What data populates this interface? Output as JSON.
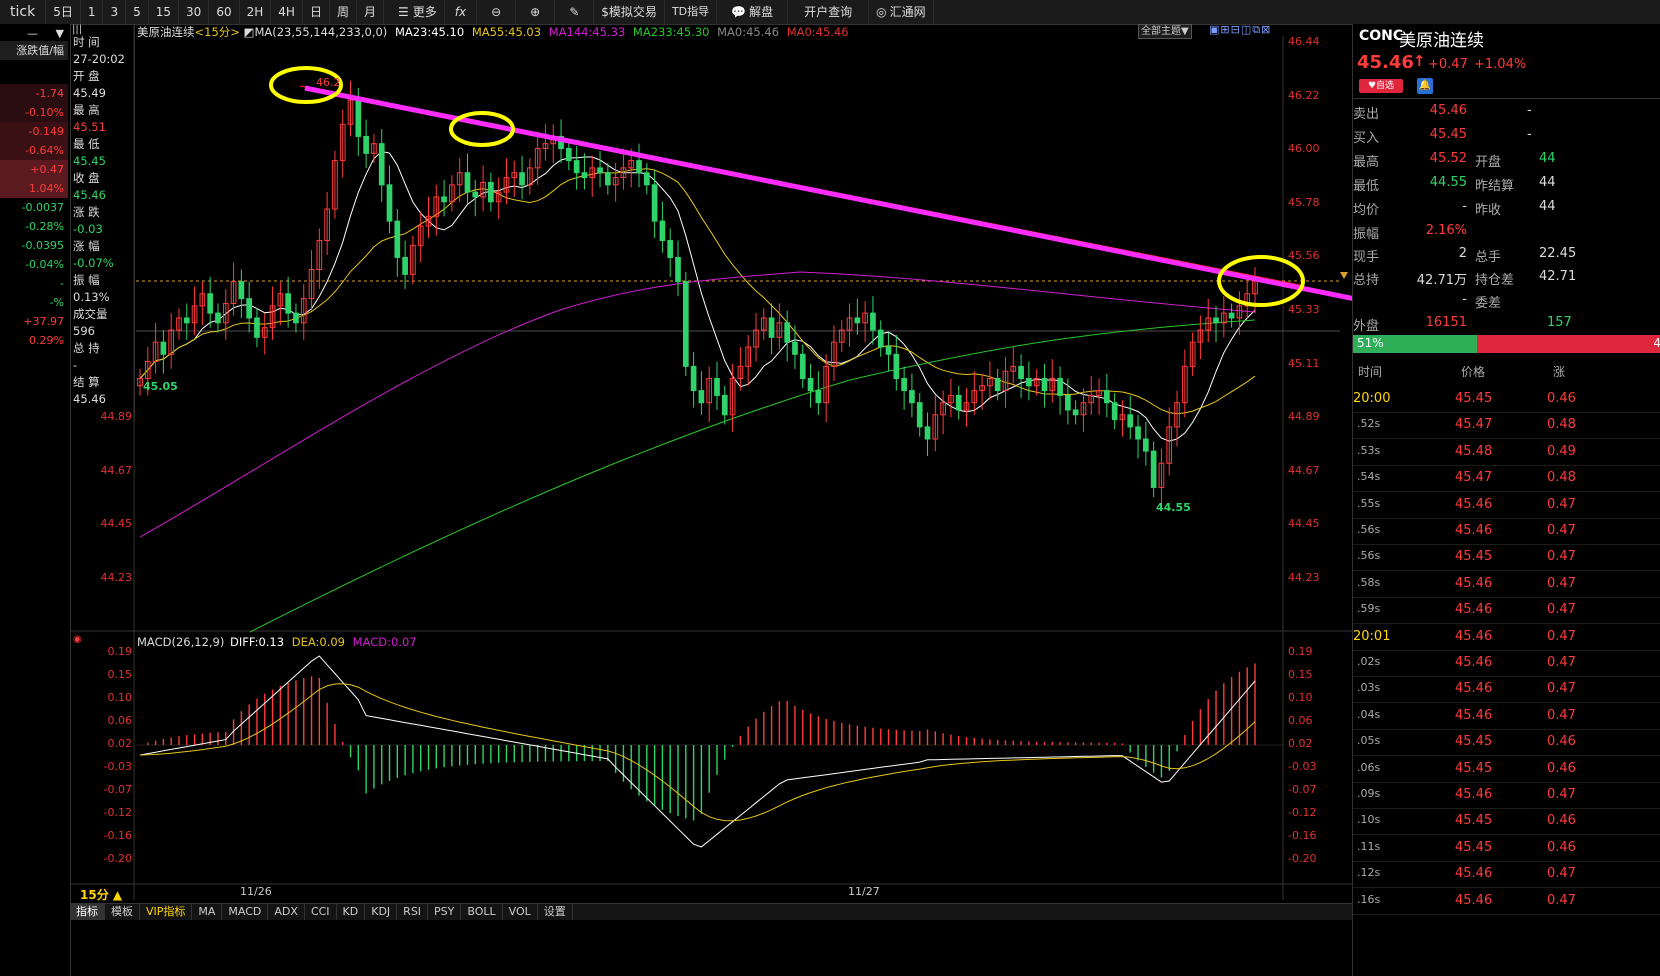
{
  "toolbar": {
    "items": [
      "tick",
      "5日",
      "1",
      "3",
      "5",
      "15",
      "30",
      "60",
      "2H",
      "4H",
      "日",
      "周",
      "月",
      "更多",
      "fx",
      "",
      "",
      "",
      "模拟交易",
      "TD指导",
      "解盘",
      "开户查询",
      "汇通网"
    ]
  },
  "left_strip": {
    "header": "涨跌值/幅",
    "rows": [
      {
        "text": "-1.74",
        "color": "red"
      },
      {
        "text": "-0.10%",
        "color": "red"
      },
      {
        "text": "-0.149",
        "color": "red"
      },
      {
        "text": "-0.64%",
        "color": "red"
      },
      {
        "text": "+0.47",
        "color": "red"
      },
      {
        "text": "1.04%",
        "color": "red"
      },
      {
        "text": "-0.0037",
        "color": "green"
      },
      {
        "text": "-0.28%",
        "color": "green"
      },
      {
        "text": "-0.0395",
        "color": "green"
      },
      {
        "text": "-0.04%",
        "color": "green"
      },
      {
        "text": "-",
        "color": "green"
      },
      {
        "text": "-%",
        "color": "green"
      },
      {
        "text": "+37.97",
        "color": "red"
      },
      {
        "text": "0.29%",
        "color": "red"
      }
    ]
  },
  "info": {
    "rows": [
      {
        "text": "时 间",
        "color": "white"
      },
      {
        "text": "27-20:02",
        "color": "white"
      },
      {
        "text": "开 盘",
        "color": "white"
      },
      {
        "text": "45.49",
        "color": "white"
      },
      {
        "text": "最 高",
        "color": "white"
      },
      {
        "text": "45.51",
        "color": "red"
      },
      {
        "text": "最 低",
        "color": "white"
      },
      {
        "text": "45.45",
        "color": "green"
      },
      {
        "text": "收 盘",
        "color": "white"
      },
      {
        "text": "45.46",
        "color": "green"
      },
      {
        "text": "涨 跌",
        "color": "white"
      },
      {
        "text": "-0.03",
        "color": "green"
      },
      {
        "text": "涨 幅",
        "color": "white"
      },
      {
        "text": "-0.07%",
        "color": "green"
      },
      {
        "text": "振 幅",
        "color": "white"
      },
      {
        "text": "0.13%",
        "color": "white"
      },
      {
        "text": "成交量",
        "color": "white"
      },
      {
        "text": "596",
        "color": "white"
      },
      {
        "text": "总 持",
        "color": "white"
      },
      {
        "text": "-",
        "color": "white"
      },
      {
        "text": "结 算",
        "color": "white"
      },
      {
        "text": "45.46",
        "color": "white"
      }
    ]
  },
  "chart_header": {
    "symbol": "美原油连续",
    "period": "<15分>",
    "ma_label": "MA(23,55,144,233,0,0)",
    "ma23": "MA23:45.10",
    "ma55": "MA55:45.03",
    "ma144": "MA144:45.33",
    "ma233": "MA233:45.30",
    "ma0a": "MA0:45.46",
    "ma0b": "MA0:45.46",
    "theme_button": "全部主题▼"
  },
  "macd_header": {
    "label": "MACD(26,12,9)",
    "diff": "DIFF:0.13",
    "dea": "DEA:0.09",
    "macd": "MACD:0.07"
  },
  "price_axis": [
    "46.44",
    "46.22",
    "46.00",
    "45.78",
    "45.56",
    "45.33",
    "45.11",
    "44.89",
    "44.67",
    "44.45",
    "44.23"
  ],
  "left_price_axis": [
    "44.89",
    "44.67",
    "44.45",
    "44.23"
  ],
  "macd_axis": [
    "0.19",
    "0.15",
    "0.10",
    "0.06",
    "0.02",
    "-0.03",
    "-0.07",
    "-0.12",
    "-0.16",
    "-0.20"
  ],
  "annotations": {
    "high_label": "46.2",
    "low_label": "44.55",
    "start_label": "45.05"
  },
  "x_axis": {
    "labels": [
      "11/26",
      "11/27"
    ],
    "period": "15分 ▲"
  },
  "bottom_tabs": [
    "指标",
    "模板",
    "VIP指标",
    "MA",
    "MACD",
    "ADX",
    "CCI",
    "KD",
    "KDJ",
    "RSI",
    "PSY",
    "BOLL",
    "VOL",
    "设置"
  ],
  "right_panel": {
    "code": "CONC",
    "name": "美原油连续",
    "price": "45.46",
    "arrow": "↑",
    "change": "+0.47",
    "change_pct": "+1.04%",
    "fav_label": "自选",
    "rows": [
      {
        "l1": "卖出",
        "v1": "45.46",
        "c1": "red",
        "l2": "",
        "v2": "-",
        "c2": "white"
      },
      {
        "l1": "买入",
        "v1": "45.45",
        "c1": "red",
        "l2": "",
        "v2": "-",
        "c2": "white"
      },
      {
        "l1": "最高",
        "v1": "45.52",
        "c1": "red",
        "l2": "开盘",
        "v2": "44",
        "c2": "green"
      },
      {
        "l1": "最低",
        "v1": "44.55",
        "c1": "green",
        "l2": "昨结算",
        "v2": "44",
        "c2": "white"
      },
      {
        "l1": "均价",
        "v1": "-",
        "c1": "white",
        "l2": "昨收",
        "v2": "44",
        "c2": "white"
      },
      {
        "l1": "振幅",
        "v1": "2.16%",
        "c1": "red",
        "l2": "",
        "v2": "",
        "c2": "white"
      },
      {
        "l1": "现手",
        "v1": "2",
        "c1": "white",
        "l2": "总手",
        "v2": "22.45",
        "c2": "white"
      },
      {
        "l1": "总持",
        "v1": "42.71万",
        "c1": "white",
        "l2": "持仓差",
        "v2": "42.71",
        "c2": "white"
      },
      {
        "l1": "",
        "v1": "-",
        "c1": "white",
        "l2": "委差",
        "v2": "",
        "c2": "white"
      },
      {
        "l1": "外盘",
        "v1": "16151",
        "c1": "red",
        "l2": "",
        "v2": "157",
        "c2": "green"
      }
    ],
    "ratio": {
      "left": "51%",
      "right": "4"
    },
    "trade_header": {
      "time": "时间",
      "price": "价格",
      "vol": "涨"
    },
    "trades": [
      {
        "t": "20:00",
        "p": "45.45",
        "v": "0.46",
        "big": true
      },
      {
        "t": ".52s",
        "p": "45.47",
        "v": "0.48",
        "big": false
      },
      {
        "t": ".53s",
        "p": "45.48",
        "v": "0.49",
        "big": false
      },
      {
        "t": ".54s",
        "p": "45.47",
        "v": "0.48",
        "big": false
      },
      {
        "t": ".55s",
        "p": "45.46",
        "v": "0.47",
        "big": false
      },
      {
        "t": ".56s",
        "p": "45.46",
        "v": "0.47",
        "big": false
      },
      {
        "t": ".56s",
        "p": "45.45",
        "v": "0.47",
        "big": false
      },
      {
        "t": ".58s",
        "p": "45.46",
        "v": "0.47",
        "big": false
      },
      {
        "t": ".59s",
        "p": "45.46",
        "v": "0.47",
        "big": false
      },
      {
        "t": "20:01",
        "p": "45.46",
        "v": "0.47",
        "big": true
      },
      {
        "t": ".02s",
        "p": "45.46",
        "v": "0.47",
        "big": false
      },
      {
        "t": ".03s",
        "p": "45.46",
        "v": "0.47",
        "big": false
      },
      {
        "t": ".04s",
        "p": "45.46",
        "v": "0.47",
        "big": false
      },
      {
        "t": ".05s",
        "p": "45.45",
        "v": "0.46",
        "big": false
      },
      {
        "t": ".06s",
        "p": "45.45",
        "v": "0.46",
        "big": false
      },
      {
        "t": ".09s",
        "p": "45.46",
        "v": "0.47",
        "big": false
      },
      {
        "t": ".10s",
        "p": "45.45",
        "v": "0.46",
        "big": false
      },
      {
        "t": ".11s",
        "p": "45.45",
        "v": "0.46",
        "big": false
      },
      {
        "t": ".12s",
        "p": "45.46",
        "v": "0.47",
        "big": false
      },
      {
        "t": ".16s",
        "p": "45.46",
        "v": "0.47",
        "big": false
      }
    ]
  },
  "colors": {
    "up": "#ff3b3b",
    "down": "#2fd36a",
    "ma23": "#ffffff",
    "ma55": "#e6c619",
    "ma144": "#d21ed2",
    "ma233": "#28c828",
    "trend": "#ff2bff",
    "circle": "#ffff00"
  }
}
